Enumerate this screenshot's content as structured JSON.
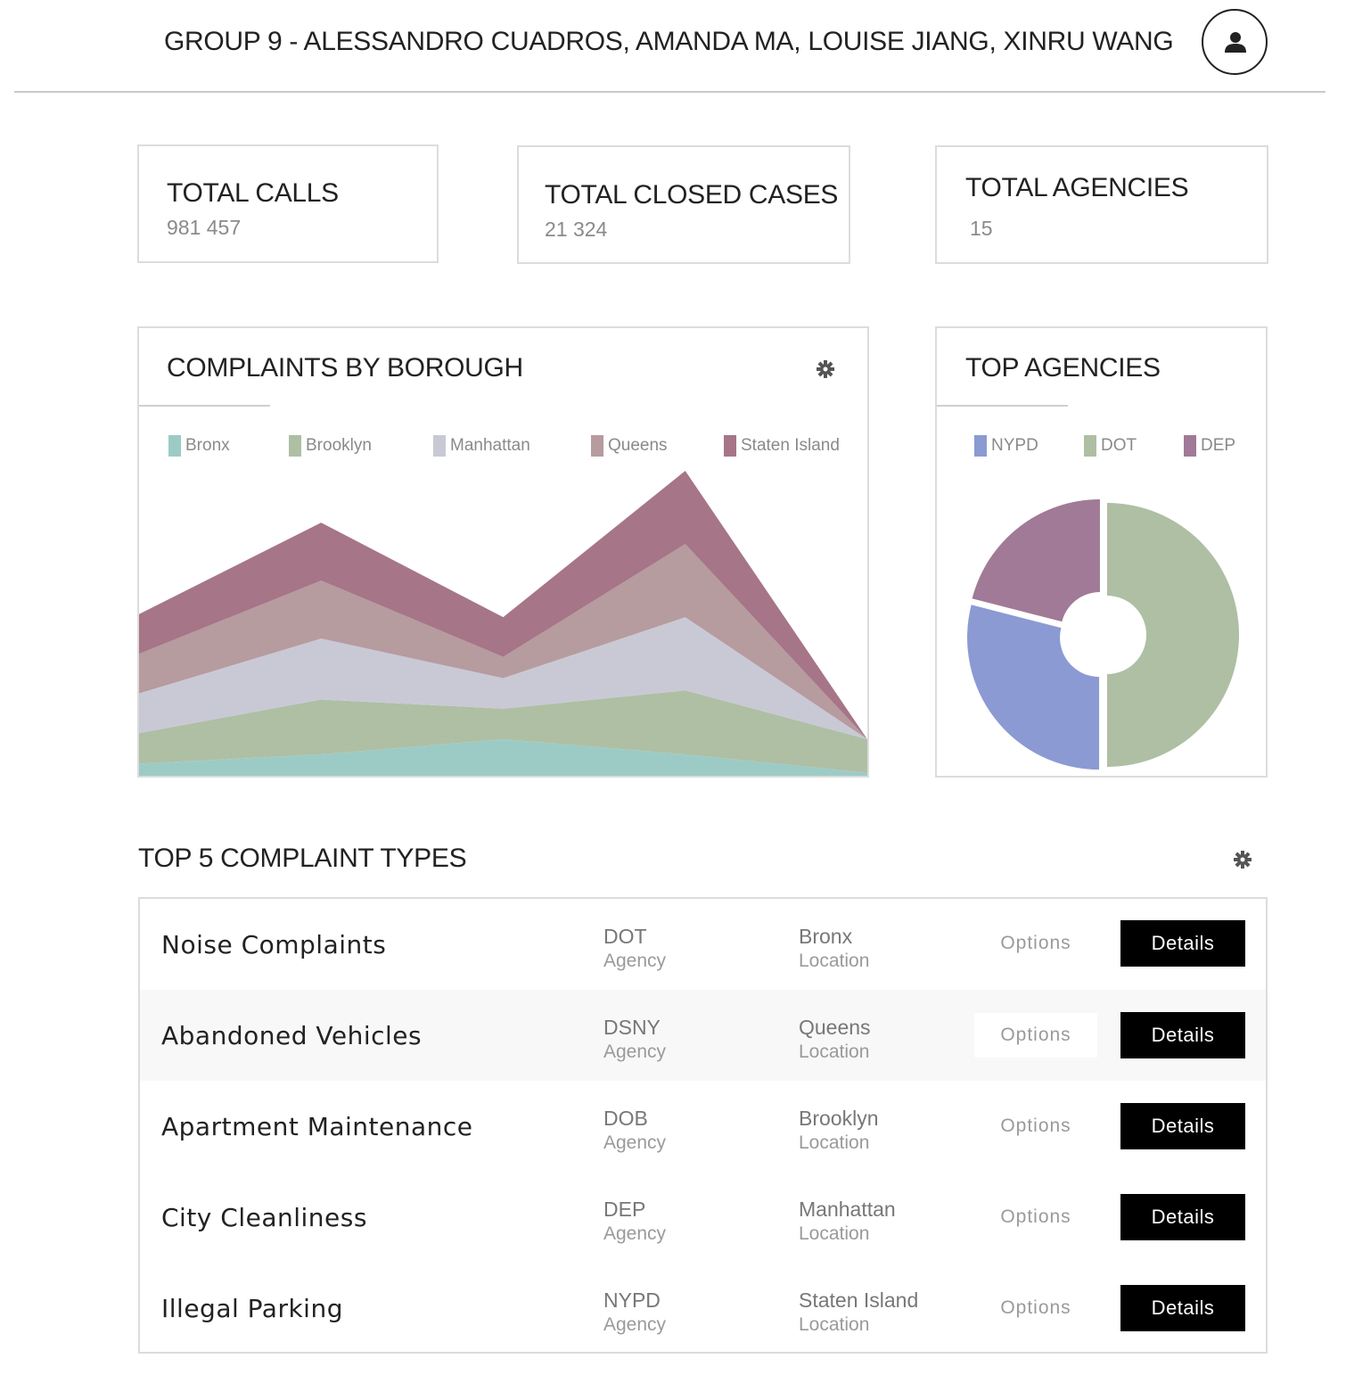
{
  "header": {
    "title": "GROUP 9 - ALESSANDRO CUADROS, AMANDA MA, LOUISE JIANG, XINRU WANG",
    "avatar_icon": "user-icon"
  },
  "stats": [
    {
      "label": "TOTAL CALLS",
      "value": "981 457"
    },
    {
      "label": "TOTAL CLOSED CASES",
      "value": "21 324"
    },
    {
      "label": "TOTAL AGENCIES",
      "value": "15"
    }
  ],
  "borough_panel": {
    "title": "COMPLAINTS BY BOROUGH",
    "settings_icon": "gear-icon"
  },
  "agencies_panel": {
    "title": "TOP AGENCIES"
  },
  "chart_data": [
    {
      "type": "area",
      "stacked": true,
      "grid": false,
      "legend_position": "top",
      "x": [
        0,
        1,
        2,
        3,
        4
      ],
      "ylim": [
        0,
        100
      ],
      "series": [
        {
          "name": "Bronx",
          "color": "#9ccbc6",
          "values": [
            4,
            7,
            12,
            7,
            1
          ]
        },
        {
          "name": "Brooklyn",
          "color": "#aebfa4",
          "values": [
            10,
            18,
            10,
            21,
            11
          ]
        },
        {
          "name": "Manhattan",
          "color": "#c9c9d6",
          "values": [
            13,
            20,
            10,
            24,
            0
          ]
        },
        {
          "name": "Queens",
          "color": "#b69b9f",
          "values": [
            13,
            19,
            7,
            24,
            0
          ]
        },
        {
          "name": "Staten Island",
          "color": "#a67588",
          "values": [
            13,
            19,
            13,
            24,
            0
          ]
        }
      ]
    },
    {
      "type": "pie",
      "donut": true,
      "legend_position": "top",
      "labels": [
        "NYPD",
        "DOT",
        "DEP"
      ],
      "values": [
        29,
        50,
        21
      ],
      "colors": [
        "#8b9ad3",
        "#aebfa4",
        "#a07a96"
      ]
    }
  ],
  "complaints": {
    "title": "TOP 5 COMPLAINT TYPES",
    "settings_icon": "gear-icon",
    "agency_sub": "Agency",
    "location_sub": "Location",
    "options_label": "Options",
    "details_label": "Details",
    "rows": [
      {
        "name": "Noise Complaints",
        "agency": "DOT",
        "location": "Bronx"
      },
      {
        "name": "Abandoned Vehicles",
        "agency": "DSNY",
        "location": "Queens"
      },
      {
        "name": "Apartment Maintenance",
        "agency": "DOB",
        "location": "Brooklyn"
      },
      {
        "name": "City Cleanliness",
        "agency": "DEP",
        "location": "Manhattan"
      },
      {
        "name": "Illegal Parking",
        "agency": "NYPD",
        "location": "Staten Island"
      }
    ]
  }
}
